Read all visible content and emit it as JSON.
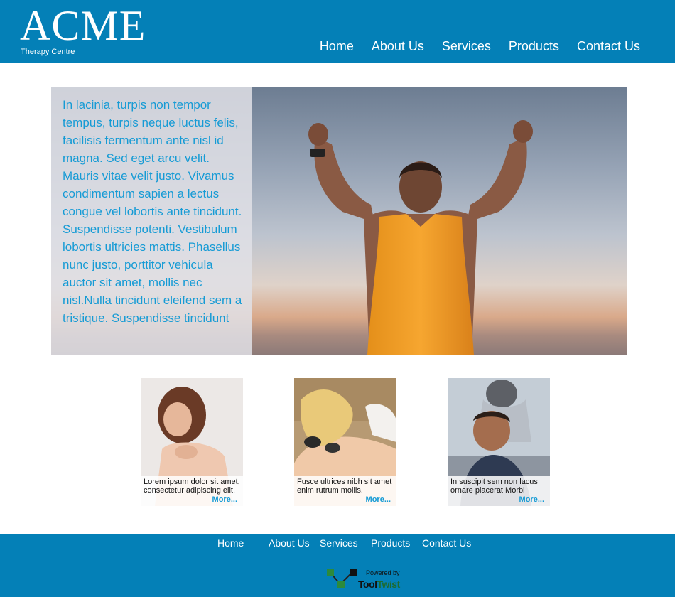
{
  "brand": {
    "name": "ACME",
    "tagline": "Therapy Centre"
  },
  "nav": [
    "Home",
    "About Us",
    "Services",
    "Products",
    "Contact Us"
  ],
  "hero": {
    "text": "In lacinia, turpis non tempor tempus, turpis neque luctus felis, facilisis fermentum ante nisl id magna. Sed eget arcu velit. Mauris vitae velit justo. Vivamus condimentum sapien a lectus congue vel lobortis ante tincidunt. Suspendisse potenti. Vestibulum lobortis ultricies mattis. Phasellus nunc justo, porttitor vehicula auctor sit amet, mollis nec nisl.Nulla tincidunt eleifend sem a tristique. Suspendisse tincidunt"
  },
  "cards": [
    {
      "caption": "Lorem ipsum dolor sit amet, consectetur adipiscing elit.",
      "more": "More..."
    },
    {
      "caption": "Fusce ultrices nibh sit amet enim rutrum mollis.",
      "more": "More..."
    },
    {
      "caption": "In suscipit sem non lacus ornare placerat Morbi",
      "more": "More..."
    }
  ],
  "footer": {
    "nav": [
      "Home",
      "About Us",
      "Services",
      "Products",
      "Contact Us"
    ],
    "powered_by": "Powered by",
    "powered_brand_a": "Tool",
    "powered_brand_b": "Twist"
  },
  "colors": {
    "header_bg": "#0480b7",
    "accent_text": "#169bd5",
    "white": "#ffffff"
  }
}
